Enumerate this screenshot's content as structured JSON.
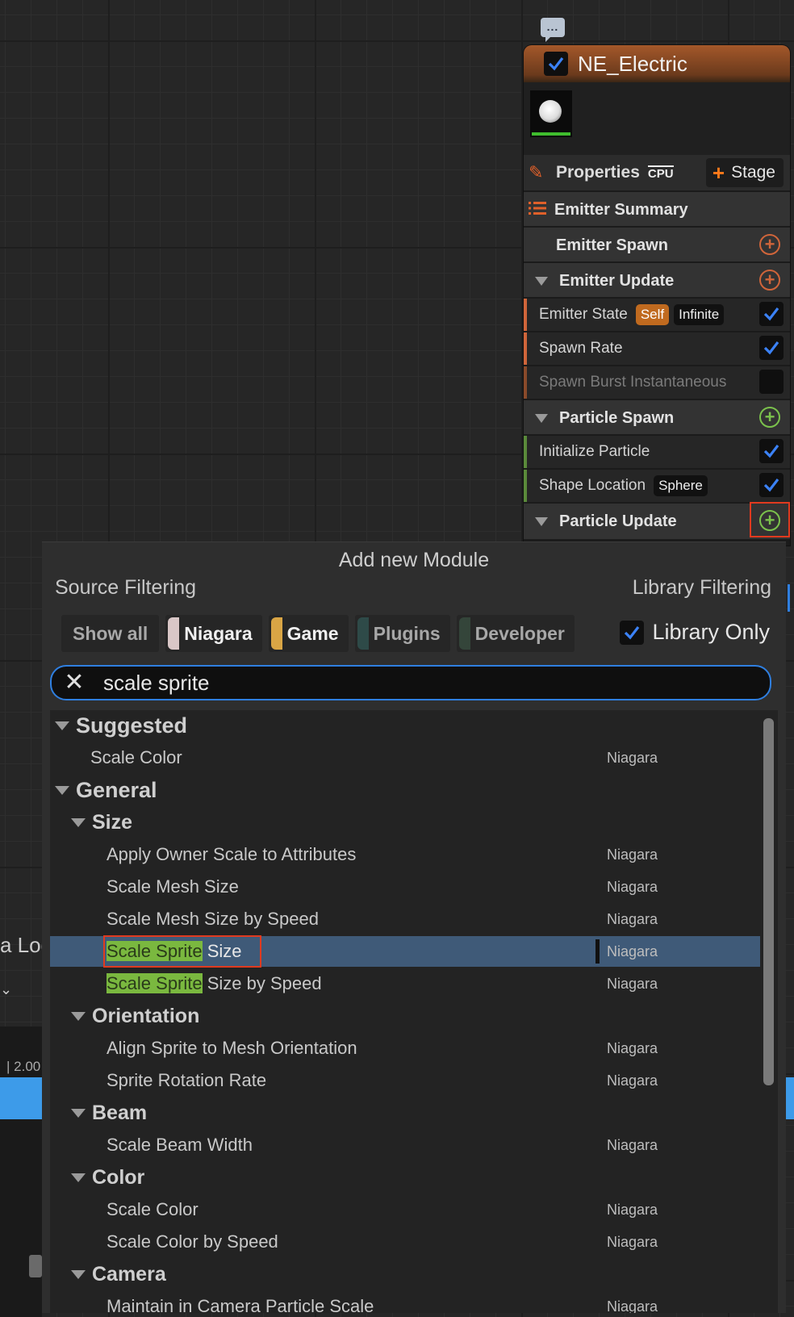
{
  "node": {
    "title": "NE_Electric",
    "properties_label": "Properties",
    "cpu_label": "CPU",
    "stage_label": "Stage",
    "sections": {
      "emitter_summary": "Emitter Summary",
      "emitter_spawn": "Emitter Spawn",
      "emitter_update": "Emitter Update",
      "particle_spawn": "Particle Spawn",
      "particle_update": "Particle Update"
    },
    "modules": {
      "emitter_state": "Emitter State",
      "emitter_state_tag1": "Self",
      "emitter_state_tag2": "Infinite",
      "spawn_rate": "Spawn Rate",
      "spawn_burst": "Spawn Burst Instantaneous",
      "initialize_particle": "Initialize Particle",
      "shape_location": "Shape Location",
      "shape_location_tag": "Sphere"
    },
    "colors": {
      "emitter_accent": "#d0653a",
      "particle_accent": "#7bc24c"
    }
  },
  "popup": {
    "title": "Add new Module",
    "source_filtering": "Source Filtering",
    "library_filtering": "Library Filtering",
    "chips": {
      "show_all": "Show all",
      "niagara": "Niagara",
      "game": "Game",
      "plugins": "Plugins",
      "developer": "Developer"
    },
    "library_only": "Library Only",
    "search_value": "scale sprite",
    "categories": {
      "suggested": "Suggested",
      "general": "General",
      "size": "Size",
      "orientation": "Orientation",
      "beam": "Beam",
      "color": "Color",
      "camera": "Camera"
    },
    "items": {
      "suggested_scale_color": "Scale Color",
      "apply_owner_scale": "Apply Owner Scale to Attributes",
      "scale_mesh_size": "Scale Mesh Size",
      "scale_mesh_size_speed": "Scale Mesh Size by Speed",
      "match": "Scale Sprite",
      "scale_sprite_size_rest": " Size",
      "scale_sprite_speed_rest": " Size by Speed",
      "align_sprite": "Align Sprite to Mesh Orientation",
      "sprite_rotation": "Sprite Rotation Rate",
      "scale_beam_width": "Scale Beam Width",
      "scale_color": "Scale Color",
      "scale_color_speed": "Scale Color by Speed",
      "maintain_camera": "Maintain in Camera Particle Scale"
    },
    "source": "Niagara"
  },
  "background": {
    "log_fragment": "a Log",
    "time_fragment": "| 2.00"
  }
}
